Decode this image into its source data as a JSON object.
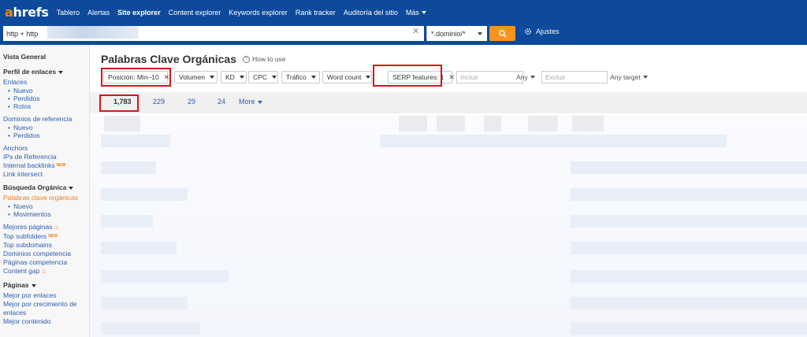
{
  "logo": {
    "first": "a",
    "rest": "hrefs"
  },
  "nav": [
    {
      "label": "Tablero",
      "active": false,
      "caret": false
    },
    {
      "label": "Alertas",
      "active": false,
      "caret": false
    },
    {
      "label": "Site explorer",
      "active": true,
      "caret": false
    },
    {
      "label": "Content explorer",
      "active": false,
      "caret": false
    },
    {
      "label": "Keywords explorer",
      "active": false,
      "caret": false
    },
    {
      "label": "Rank tracker",
      "active": false,
      "caret": false
    },
    {
      "label": "Auditoría del sitio",
      "active": false,
      "caret": false
    },
    {
      "label": "Más",
      "active": false,
      "caret": true
    }
  ],
  "search": {
    "value": "http + http",
    "clear_icon": "close-icon"
  },
  "mode": {
    "value": "*.dominio/*"
  },
  "settings": {
    "label": "Ajustes",
    "icon": "gear-icon"
  },
  "sidebar": {
    "vista_general": "Vista General",
    "perfil": "Perfil de enlaces",
    "enlaces": "Enlaces",
    "enlaces_sub": [
      "Nuevo",
      "Perdidos",
      "Rotos"
    ],
    "dominios_ref": "Dominios de referencia",
    "dominios_sub": [
      "Nuevo",
      "Perdidos"
    ],
    "anchors": "Anchors",
    "ips": "IPs de Referencia",
    "internal": "Internal backlinks",
    "new_badge": "NEW",
    "link_intersect": "Link intersect",
    "busqueda": "Búsqueda Orgánica",
    "palabras": "Palabras clave orgánicas",
    "palabras_sub": [
      "Nuevo",
      "Movimientos"
    ],
    "mejores": "Mejores páginas",
    "top_subfolders": "Top subfolders",
    "top_subdomains": "Top subdomains",
    "dominios_comp": "Dominios competencia",
    "paginas_comp": "Páginas competencia",
    "content_gap": "Content gap",
    "paginas": "Páginas",
    "mejor_enlaces": "Mejor por enlaces",
    "mejor_crec_1": "Mejor por crecimiento de",
    "mejor_crec_2": "enlaces",
    "mejor_contenido": "Mejor contenido"
  },
  "main": {
    "title": "Palabras Clave Orgánicas",
    "info_icon": "info-icon",
    "howto": "How to use",
    "filters": {
      "posicion": "Posición: Min–10",
      "volumen": "Volumen",
      "kd": "KD",
      "cpc": "CPC",
      "trafico": "Tráfico",
      "word_count": "Word count",
      "serp": "SERP features: 1",
      "incluir_placeholder": "Incluir",
      "any1": "Any",
      "excluir_placeholder": "Excluir",
      "any_target": "Any target"
    },
    "tabs": [
      "1,783",
      "229",
      "29",
      "24",
      "More"
    ]
  },
  "colors": {
    "nav_bg": "#0d4a9b",
    "accent_orange": "#f7931e",
    "highlight_red": "#d9141b",
    "link_blue": "#2a5db0"
  }
}
